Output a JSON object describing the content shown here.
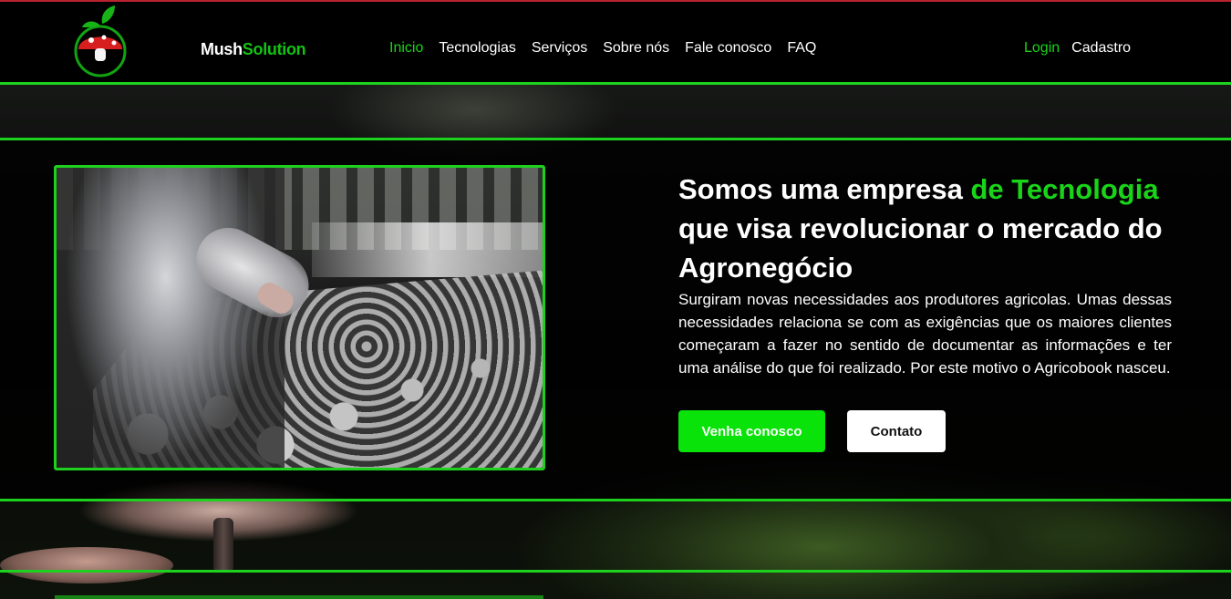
{
  "brand": {
    "name_part1": "Mush",
    "name_part2": "Solution"
  },
  "nav": {
    "items": [
      {
        "label": "Inicio",
        "active": true
      },
      {
        "label": "Tecnologias",
        "active": false
      },
      {
        "label": "Serviços",
        "active": false
      },
      {
        "label": "Sobre nós",
        "active": false
      },
      {
        "label": "Fale conosco",
        "active": false
      },
      {
        "label": "FAQ",
        "active": false
      }
    ]
  },
  "auth": {
    "login_label": "Login",
    "signup_label": "Cadastro"
  },
  "hero": {
    "headline_part1": "Somos uma empresa ",
    "headline_accent": "de Tecnologia",
    "headline_part2": " que visa revolucionar o mercado do Agronegócio",
    "description": "Surgiram novas necessidades aos produtores agricolas. Umas dessas necessidades relaciona se com as exigências que os maiores clientes começaram a fazer no sentido de documentar as informações e ter uma análise do que foi realizado. Por este motivo o Agricobook nasceu.",
    "primary_button": "Venha conosco",
    "secondary_button": "Contato"
  },
  "colors": {
    "accent_green": "#19d419",
    "button_green": "#09e309",
    "top_line": "#b8232f"
  }
}
